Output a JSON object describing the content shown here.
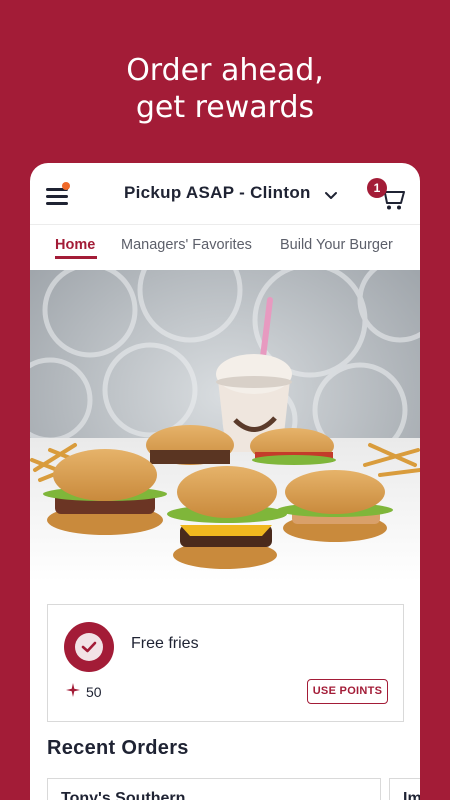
{
  "headline": {
    "line1": "Order ahead,",
    "line2": "get rewards"
  },
  "header": {
    "location": "Pickup ASAP - Clinton",
    "cart_count": "1"
  },
  "tabs": [
    {
      "label": "Home",
      "active": true
    },
    {
      "label": "Managers' Favorites",
      "active": false
    },
    {
      "label": "Build Your Burger",
      "active": false
    }
  ],
  "reward": {
    "title": "Free fries",
    "points": "50",
    "button_label": "USE POINTS"
  },
  "recent_orders": {
    "title": "Recent Orders",
    "items": [
      {
        "name": "Tony's Southern"
      },
      {
        "name": "Im"
      }
    ]
  },
  "colors": {
    "brand": "#a31c37",
    "notification": "#f06a2a",
    "text": "#1f2333"
  },
  "icons": [
    "menu-icon",
    "chevron-down-icon",
    "cart-icon",
    "check-badge-icon",
    "sparkle-icon"
  ]
}
